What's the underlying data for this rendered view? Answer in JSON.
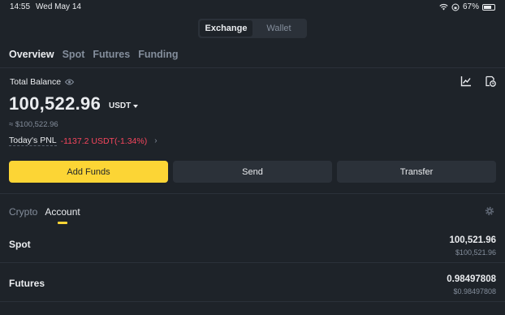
{
  "status_bar": {
    "time": "14:55",
    "date": "Wed May 14",
    "battery": "67%"
  },
  "segments": [
    "Exchange",
    "Wallet"
  ],
  "tabs": [
    "Overview",
    "Spot",
    "Futures",
    "Funding"
  ],
  "total_balance": {
    "label": "Total Balance",
    "amount": "100,522.96",
    "currency": "USDT",
    "fiat": "≈ $100,522.96"
  },
  "pnl": {
    "label": "Today's PNL",
    "value": "-1137.2 USDT(-1.34%)"
  },
  "actions": {
    "add_funds": "Add Funds",
    "send": "Send",
    "transfer": "Transfer"
  },
  "account_tabs": [
    "Crypto",
    "Account"
  ],
  "accounts": [
    {
      "name": "Spot",
      "amount": "100,521.96",
      "fiat": "$100,521.96"
    },
    {
      "name": "Futures",
      "amount": "0.98497808",
      "fiat": "$0.98497808"
    }
  ],
  "colors": {
    "accent": "#fcd535",
    "negative": "#f6465d",
    "background": "#1e2329"
  },
  "icons": [
    "wifi-icon",
    "battery-icon",
    "eye-icon",
    "chart-icon",
    "history-icon",
    "gear-icon",
    "chevron-right-icon"
  ]
}
